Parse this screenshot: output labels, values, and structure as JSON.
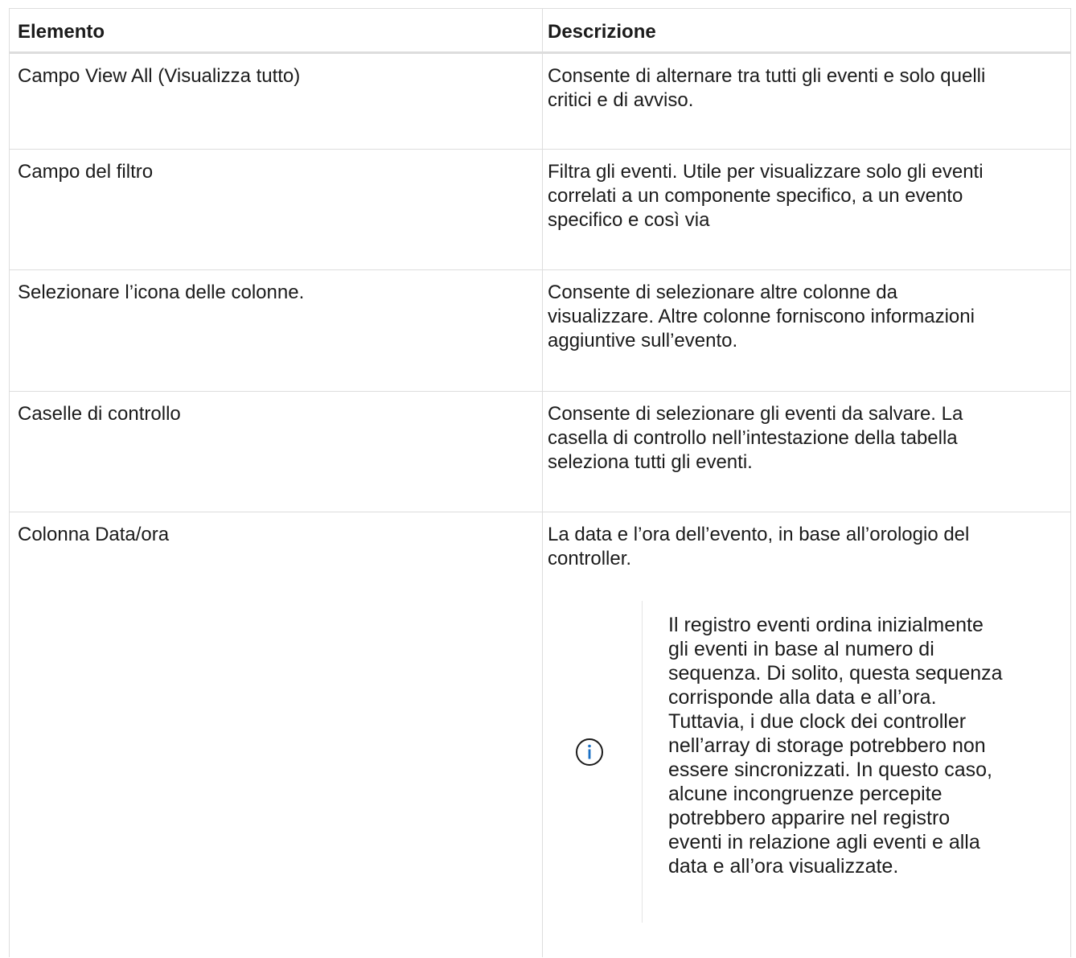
{
  "header": {
    "col1": "Elemento",
    "col2": "Descrizione"
  },
  "rows": [
    {
      "element": "Campo View All (Visualizza tutto)",
      "description": "Consente di alternare tra tutti gli eventi e solo quelli\ncritici e di avviso."
    },
    {
      "element": "Campo del filtro",
      "description": "Filtra gli eventi. Utile per visualizzare solo gli eventi\ncorrelati a un componente specifico, a un evento\nspecifico e così via"
    },
    {
      "element": "Selezionare l’icona delle colonne.",
      "description": "Consente di selezionare altre colonne da\nvisualizzare. Altre colonne forniscono informazioni\naggiuntive sull’evento."
    },
    {
      "element": "Caselle di controllo",
      "description": "Consente di selezionare gli eventi da salvare. La\ncasella di controllo nell’intestazione della tabella\nseleziona tutti gli eventi."
    },
    {
      "element": "Colonna Data/ora",
      "description": "La data e l’ora dell’evento, in base all’orologio del\ncontroller.",
      "note": {
        "icon": "info-icon",
        "text": "Il registro eventi ordina inizialmente\ngli eventi in base al numero di\nsequenza. Di solito, questa sequenza\ncorrisponde alla data e all’ora.\nTuttavia, i due clock dei controller\nnell’array di storage potrebbero non\nessere sincronizzati. In questo caso,\nalcune incongruenze percepite\npotrebbero apparire nel registro\neventi in relazione agli eventi e alla\ndata e all’ora visualizzate."
      }
    }
  ],
  "colors": {
    "border": "#dddddd",
    "icon": "#1a6fc4",
    "text": "#1b1b1b"
  }
}
